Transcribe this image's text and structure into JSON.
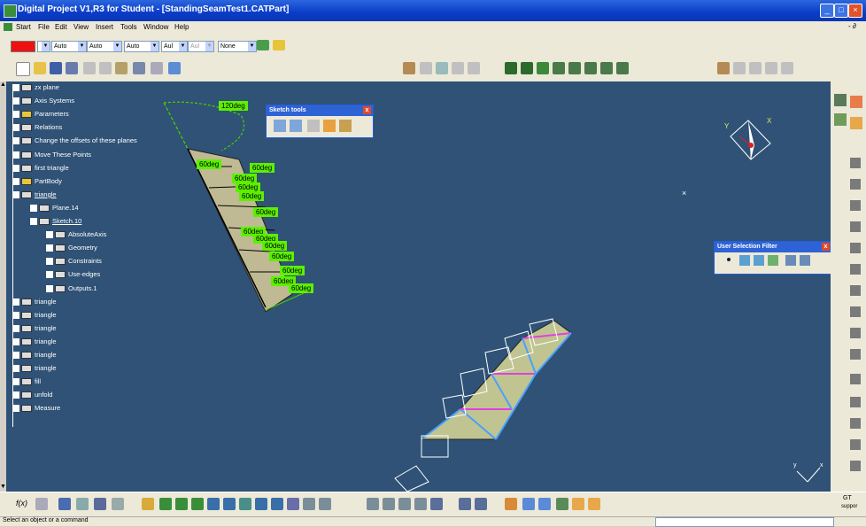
{
  "window": {
    "title": "Digital Project V1,R3 for Student - [StandingSeamTest1.CATPart]",
    "min": "_",
    "max": "□",
    "close": "×",
    "inner_controls": "- ∂"
  },
  "menu": [
    "Start",
    "File",
    "Edit",
    "View",
    "Insert",
    "Tools",
    "Window",
    "Help"
  ],
  "props": {
    "color_value": "",
    "combos": [
      "Auto",
      "Auto",
      "Auto",
      "Aul",
      "Aul",
      "None"
    ]
  },
  "tree": {
    "items": [
      {
        "label": "zx plane",
        "icon": "plane-icon"
      },
      {
        "label": "Axis Systems",
        "icon": "axis-icon"
      },
      {
        "label": "Parameters",
        "icon": "parameters-icon"
      },
      {
        "label": "Relations",
        "icon": "relations-icon"
      },
      {
        "label": "Change the offsets of these planes",
        "icon": "geoset-icon"
      },
      {
        "label": "Move These Points",
        "icon": "geoset-icon"
      },
      {
        "label": "first triangle",
        "icon": "geoset-icon"
      },
      {
        "label": "PartBody",
        "icon": "body-icon"
      },
      {
        "label": "triangle",
        "icon": "geoset-icon"
      },
      {
        "label": "Plane.14",
        "icon": "plane-icon"
      },
      {
        "label": "Sketch.10",
        "icon": "sketch-icon"
      },
      {
        "label": "AbsoluteAxis",
        "icon": "axis-icon"
      },
      {
        "label": "Geometry",
        "icon": "geometry-icon"
      },
      {
        "label": "Constraints",
        "icon": "constraints-icon"
      },
      {
        "label": "Use-edges",
        "icon": "geoset-icon"
      },
      {
        "label": "Outputs.1",
        "icon": "outputs-icon"
      },
      {
        "label": "triangle",
        "icon": "geoset-icon"
      },
      {
        "label": "triangle",
        "icon": "geoset-icon"
      },
      {
        "label": "triangle",
        "icon": "geoset-icon"
      },
      {
        "label": "triangle",
        "icon": "geoset-icon"
      },
      {
        "label": "triangle",
        "icon": "geoset-icon"
      },
      {
        "label": "triangle",
        "icon": "geoset-icon"
      },
      {
        "label": "fill",
        "icon": "geoset-icon"
      },
      {
        "label": "unfold",
        "icon": "geoset-icon"
      },
      {
        "label": "Measure",
        "icon": "measure-icon"
      }
    ]
  },
  "palettes": {
    "sketch_tools": {
      "title": "Sketch tools",
      "close": "x"
    },
    "selection_filter": {
      "title": "User Selection Filter",
      "close": "x"
    }
  },
  "angles": {
    "top": "120deg",
    "a1": "60deg",
    "a2": "60deg",
    "a3": "60deg",
    "a4": "60deg",
    "a5": "60deg",
    "a6": "60deg",
    "a7": "60deg",
    "a8": "60deg",
    "a9": "60deg",
    "a10": "60deg",
    "a11": "60deg",
    "a12": "60deg",
    "a13": "60deg"
  },
  "compass": {
    "y": "Y",
    "x": "X"
  },
  "axis_corner": {
    "y": "y",
    "x": "x"
  },
  "formula_label": "f(x)",
  "right_labels": {
    "gt": "GT",
    "support": "suppor"
  },
  "status": "Select an object or a command"
}
